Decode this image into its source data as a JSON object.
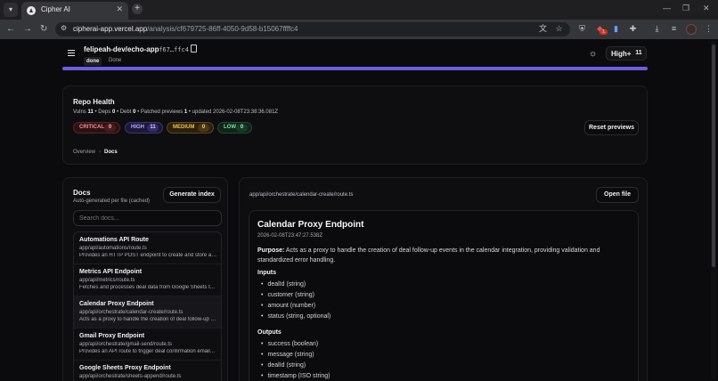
{
  "browser": {
    "tab_title": "Cipher AI",
    "url_host": "cipherai-app.vercel.app",
    "url_path": "/analysis/cf679725-86ff-4050-9d58-b15067ffffc4",
    "extension_badge": "1",
    "icons": [
      "tab-list-icon",
      "new-tab-icon",
      "minimize-icon",
      "maximize-icon",
      "close-window-icon",
      "back-icon",
      "forward-icon",
      "reload-icon",
      "site-info-icon",
      "translate-icon",
      "bookmark-star-icon",
      "shield-extension-icon",
      "extension-icon",
      "extensions-puzzle-icon",
      "download-icon",
      "media-icon",
      "profile-avatar-icon",
      "menu-kebab-icon"
    ]
  },
  "header": {
    "repo": "felipeah-dev/echo-app",
    "commit": "cf67…ffc4",
    "status_badge": "done",
    "status_text": "Done",
    "severity_label": "High+",
    "severity_count": "11",
    "progress_fraction": 1.0,
    "accent_color": "#6a5fe0"
  },
  "repo_health": {
    "title": "Repo Health",
    "stats": {
      "vulns_label": "Vulns",
      "vulns": "11",
      "deps_label": "Deps",
      "deps": "0",
      "debt_label": "Debt",
      "debt": "0",
      "patched_label": "Patched previews",
      "patched": "1",
      "updated_label": "updated",
      "updated": "2026-02-08T23:38:36.081Z"
    },
    "chips": {
      "critical": {
        "label": "CRITICAL",
        "count": "0",
        "color": "#ff8f8f"
      },
      "high": {
        "label": "HIGH",
        "count": "11",
        "color": "#b4acff"
      },
      "medium": {
        "label": "MEDIUM",
        "count": "0",
        "color": "#f2c04b"
      },
      "low": {
        "label": "LOW",
        "count": "0",
        "color": "#7fe0a3"
      }
    },
    "reset_label": "Reset previews",
    "breadcrumb": [
      "Overview",
      "Docs"
    ],
    "breadcrumb_sep": "›"
  },
  "docs": {
    "title": "Docs",
    "subtitle": "Auto-generated per file (cached)",
    "generate_label": "Generate index",
    "search_placeholder": "Search docs...",
    "items": [
      {
        "name": "Automations API Route",
        "path": "app/api/automations/route.ts",
        "desc": "Provides an HTTP POST endpoint to create and store automation rules"
      },
      {
        "name": "Metrics API Endpoint",
        "path": "app/api/metrics/route.ts",
        "desc": "Fetches and processes deal data from Google Sheets to compute metrics"
      },
      {
        "name": "Calendar Proxy Endpoint",
        "path": "app/api/orchestrate/calendar-create/route.ts",
        "desc": "Acts as a proxy to handle the creation of deal follow-up events"
      },
      {
        "name": "Gmail Proxy Endpoint",
        "path": "app/api/orchestrate/gmail-send/route.ts",
        "desc": "Provides an API route to trigger deal confirmation emails via Gmail"
      },
      {
        "name": "Google Sheets Proxy Endpoint",
        "path": "app/api/orchestrate/sheets-append/route.ts",
        "desc": ""
      }
    ]
  },
  "viewer": {
    "file_path": "app/api/orchestrate/calendar-create/route.ts",
    "open_label": "Open file",
    "heading": "Calendar Proxy Endpoint",
    "timestamp": "2026-02-08T23:47:27.538Z",
    "purpose_label": "Purpose:",
    "purpose_text": "Acts as a proxy to handle the creation of deal follow-up events in the calendar integration, providing validation and standardized error handling.",
    "inputs_label": "Inputs",
    "inputs": [
      "dealId (string)",
      "customer (string)",
      "amount (number)",
      "status (string, optional)"
    ],
    "outputs_label": "Outputs",
    "outputs": [
      "success (boolean)",
      "message (string)",
      "dealId (string)",
      "timestamp (ISO string)"
    ]
  }
}
